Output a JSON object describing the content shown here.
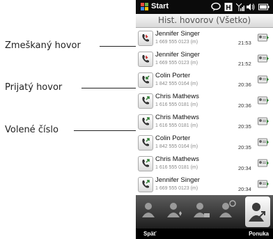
{
  "callouts": {
    "missed": "Zmeškaný hovor",
    "received": "Prijatý hovor",
    "dialed": "Volené číslo"
  },
  "status_bar": {
    "title": "Start"
  },
  "screen_title": "Hist. hovorov (Všetko)",
  "calls": [
    {
      "type": "missed",
      "name": "Jennifer Singer",
      "number": "1 669 555 0123 (m)",
      "time": "21:53"
    },
    {
      "type": "missed",
      "name": "Jennifer Singer",
      "number": "1 669 555 0123 (m)",
      "time": "21:52"
    },
    {
      "type": "received",
      "name": "Colin Porter",
      "number": "1 842 555 0164 (m)",
      "time": "20:36"
    },
    {
      "type": "dialed",
      "name": "Chris Mathews",
      "number": "1 616 555 0181 (m)",
      "time": "20:36"
    },
    {
      "type": "dialed",
      "name": "Chris Mathews",
      "number": "1 616 555 0181 (m)",
      "time": "20:35"
    },
    {
      "type": "dialed",
      "name": "Colin Porter",
      "number": "1 842 555 0164 (m)",
      "time": "20:35"
    },
    {
      "type": "dialed",
      "name": "Chris Mathews",
      "number": "1 616 555 0181 (m)",
      "time": "20:34"
    },
    {
      "type": "dialed",
      "name": "Jennifer Singer",
      "number": "1 669 555 0123 (m)",
      "time": "20:34"
    }
  ],
  "softkeys": {
    "left": "Späť",
    "right": "Ponuka"
  },
  "icons": {
    "missed": "missed-call-icon",
    "received": "received-call-icon",
    "dialed": "dialed-call-icon",
    "contact_card": "contact-card-icon"
  },
  "colors": {
    "missed_arrow": "#c62828",
    "received_arrow": "#2e7d32",
    "dialed_arrow": "#2e7d32"
  }
}
